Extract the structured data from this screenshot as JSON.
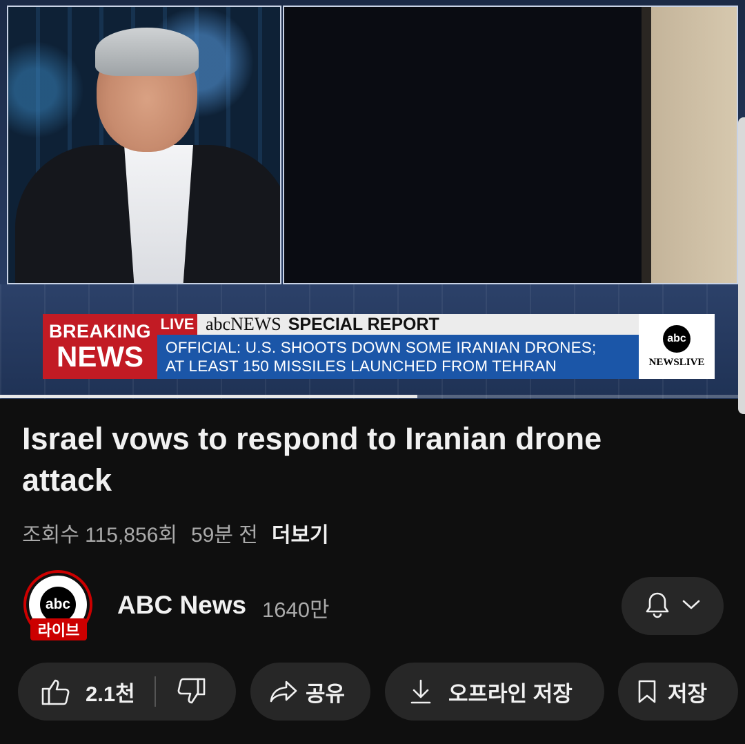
{
  "player": {
    "lower_third": {
      "breaking_line1": "BREAKING",
      "breaking_line2": "NEWS",
      "live_tag": "LIVE",
      "network": "abcNEWS",
      "special_report": "SPECIAL REPORT",
      "headline_line1": "OFFICIAL: U.S. SHOOTS DOWN SOME IRANIAN DRONES;",
      "headline_line2": "AT LEAST 150 MISSILES LAUNCHED FROM TEHRAN",
      "logo_text": "abc",
      "logo_sub": "NEWSLIVE"
    },
    "progress_fraction": 0.56
  },
  "video": {
    "title": "Israel vows to respond to Iranian drone attack",
    "views": "조회수 115,856회",
    "age": "59분 전",
    "more_label": "더보기"
  },
  "channel": {
    "avatar_text": "abc",
    "live_badge": "라이브",
    "name": "ABC News",
    "subscribers": "1640만",
    "bell_icon": "bell-icon",
    "dropdown_icon": "chevron-down-icon"
  },
  "actions": {
    "like_count": "2.1천",
    "share_label": "공유",
    "download_label": "오프라인 저장",
    "save_label": "저장"
  },
  "colors": {
    "background": "#0f0f0f",
    "chip": "#272727",
    "accent_red": "#cc0000",
    "breaking_red": "#c21b24",
    "headline_blue": "#1b56a8"
  }
}
